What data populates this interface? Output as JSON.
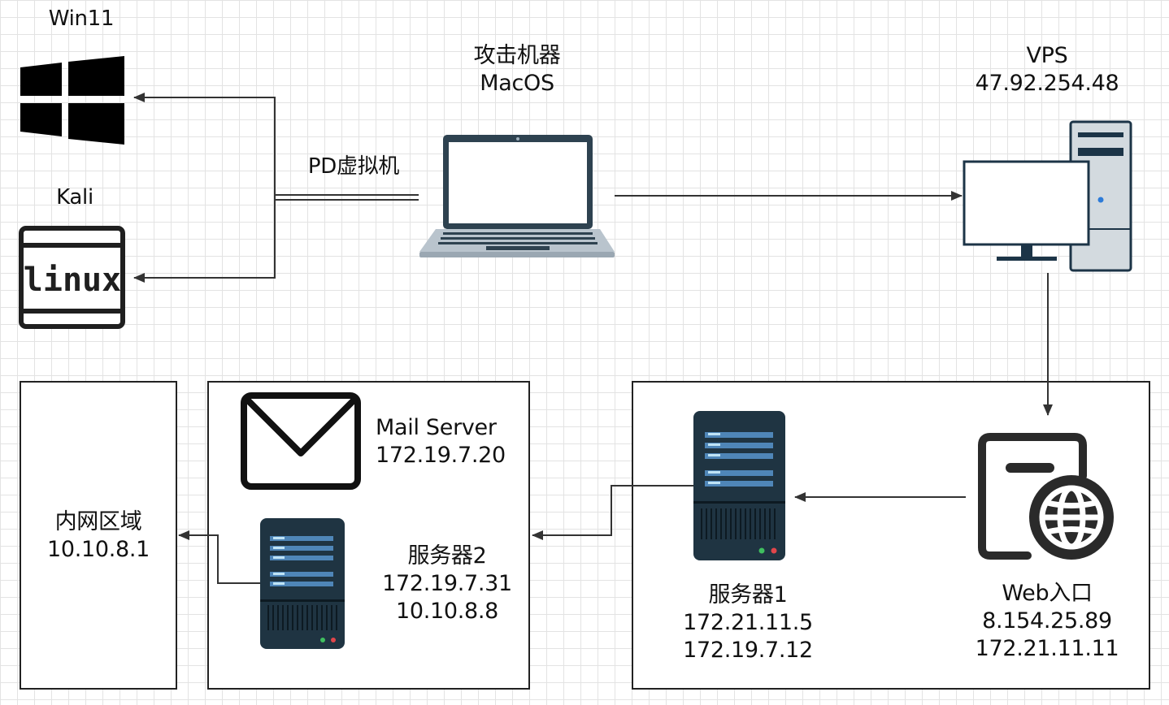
{
  "nodes": {
    "win11": {
      "title": "Win11"
    },
    "kali": {
      "title": "Kali",
      "logo_text": "linux"
    },
    "attacker": {
      "line1": "攻击机器",
      "line2": "MacOS"
    },
    "pd_vm": {
      "label": "PD虚拟机"
    },
    "vps": {
      "line1": "VPS",
      "line2": "47.92.254.48"
    },
    "mail_server": {
      "line1": "Mail Server",
      "line2": "172.19.7.20"
    },
    "server2": {
      "line1": "服务器2",
      "line2": "172.19.7.31",
      "line3": "10.10.8.8"
    },
    "intranet": {
      "line1": "内网区域",
      "line2": "10.10.8.1"
    },
    "server1": {
      "line1": "服务器1",
      "line2": "172.21.11.5",
      "line3": "172.19.7.12"
    },
    "web_entry": {
      "line1": "Web入口",
      "line2": "8.154.25.89",
      "line3": "172.21.11.11"
    }
  },
  "colors": {
    "line": "#333333",
    "server_body": "#1f3442",
    "server_bar": "#4f86b8",
    "laptop_frame": "#2e4250",
    "laptop_keyboard": "#b9c4cd",
    "vps_screen_border": "#1c3447",
    "vps_tower": "#cfd6dc"
  },
  "icons": [
    "windows-icon",
    "linux-icon",
    "laptop-icon",
    "desktop-pc-icon",
    "mail-icon",
    "server-icon",
    "web-globe-icon"
  ]
}
